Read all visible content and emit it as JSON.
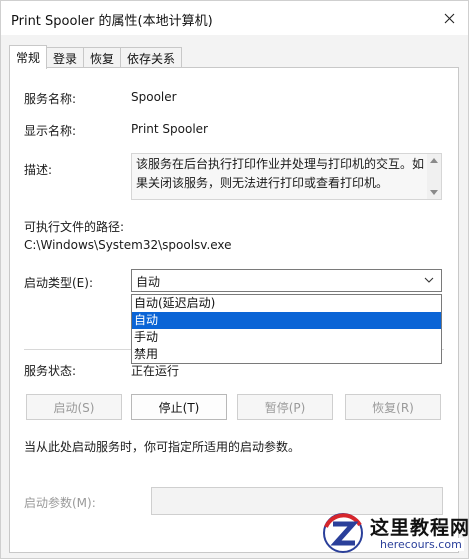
{
  "window": {
    "title": "Print Spooler 的属性(本地计算机)",
    "close_icon": "close-icon"
  },
  "tabs": [
    {
      "label": "常规",
      "active": true
    },
    {
      "label": "登录",
      "active": false
    },
    {
      "label": "恢复",
      "active": false
    },
    {
      "label": "依存关系",
      "active": false
    }
  ],
  "general": {
    "service_name_label": "服务名称:",
    "service_name_value": "Spooler",
    "display_name_label": "显示名称:",
    "display_name_value": "Print Spooler",
    "description_label": "描述:",
    "description_text": "该服务在后台执行打印作业并处理与打印机的交互。如果关闭该服务，则无法进行打印或查看打印机。",
    "exe_path_label": "可执行文件的路径:",
    "exe_path_value": "C:\\Windows\\System32\\spoolsv.exe",
    "startup_type_label": "启动类型(E):",
    "startup_type_value": "自动",
    "startup_options": [
      "自动(延迟启动)",
      "自动",
      "手动",
      "禁用"
    ],
    "startup_selected_index": 1,
    "service_status_label": "服务状态:",
    "service_status_value": "正在运行",
    "buttons": {
      "start": "启动(S)",
      "stop": "停止(T)",
      "pause": "暂停(P)",
      "resume": "恢复(R)"
    },
    "hint_text": "当从此处启动服务时，你可指定所适用的启动参数。",
    "start_params_label": "启动参数(M):"
  },
  "watermark": {
    "title": "这里教程网",
    "subtitle": "herecours.com"
  },
  "colors": {
    "accent": "#0a64d6",
    "disabled_text": "#9a9a9a"
  }
}
